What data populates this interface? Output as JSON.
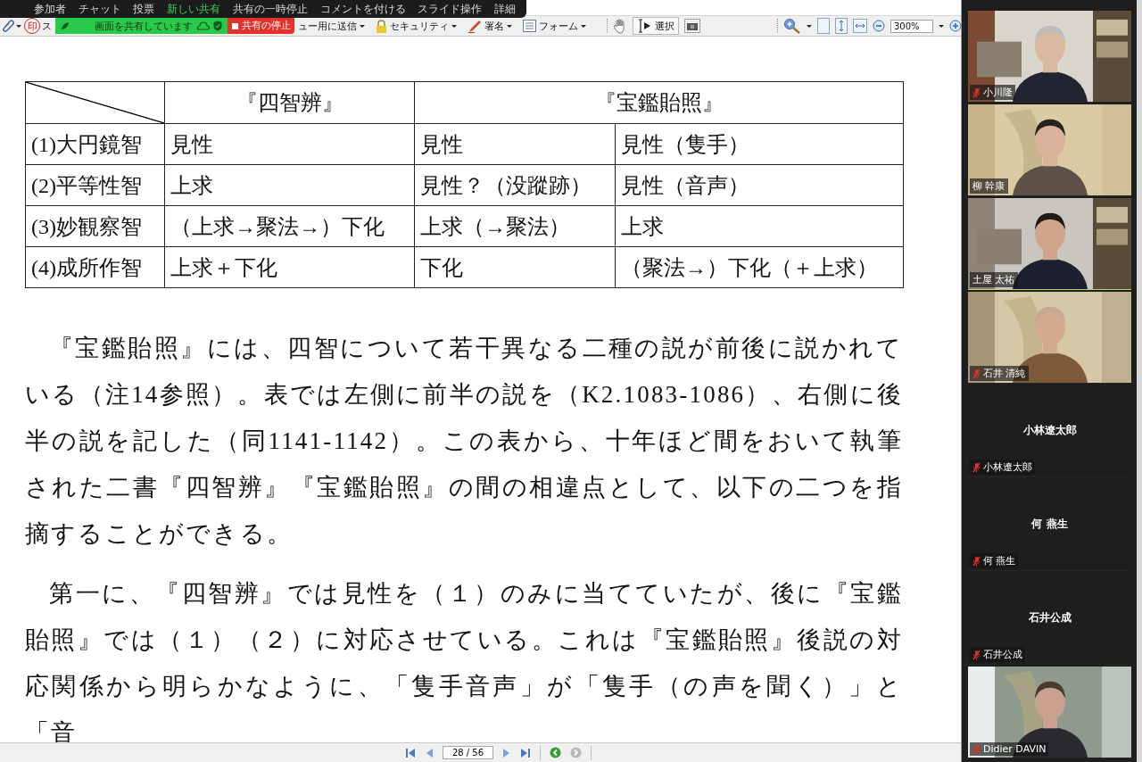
{
  "zoom_toolbar": {
    "items": [
      {
        "label": "参加者",
        "highlighted": false
      },
      {
        "label": "チャット",
        "highlighted": false
      },
      {
        "label": "投票",
        "highlighted": false
      },
      {
        "label": "新しい共有",
        "highlighted": true
      },
      {
        "label": "共有の一時停止",
        "highlighted": false
      },
      {
        "label": "コメントを付ける",
        "highlighted": false
      },
      {
        "label": "スライド操作",
        "highlighted": false
      },
      {
        "label": "詳細",
        "highlighted": false
      }
    ]
  },
  "share_banner": {
    "status": "画面を共有しています",
    "stop_button": "共有の停止"
  },
  "pdf_toolbar": {
    "stamp_icon_text": "印",
    "partial_label": "ス",
    "buttons": [
      {
        "label": "ュー用に送信",
        "kind": "text"
      },
      {
        "label": "セキュリティ",
        "kind": "lock"
      },
      {
        "label": "署名",
        "kind": "pen"
      },
      {
        "label": "フォーム",
        "kind": "form"
      }
    ],
    "select_tool": "選択",
    "zoom": "300%"
  },
  "table": {
    "header": [
      "『四智辨』",
      "『宝鑑貽照』"
    ],
    "rows": [
      [
        "(1)大円鏡智",
        "見性",
        "見性",
        "見性（隻手）"
      ],
      [
        "(2)平等性智",
        "上求",
        "見性？（没蹤跡）",
        "見性（音声）"
      ],
      [
        "(3)妙観察智",
        "（上求→聚法→）下化",
        "上求（→聚法）",
        "上求"
      ],
      [
        "(4)成所作智",
        "上求＋下化",
        "下化",
        "（聚法→）下化（＋上求）"
      ]
    ]
  },
  "paragraphs": [
    "『宝鑑貽照』には、四智について若干異なる二種の説が前後に説かれている（注14参照）。表では左側に前半の説を（K2.1083-1086）、右側に後半の説を記した（同1141-1142）。この表から、十年ほど間をおいて執筆された二書『四智辨』『宝鑑貽照』の間の相違点として、以下の二つを指摘することができる。",
    "第一に、『四智辨』では見性を（１）のみに当てていたが、後に『宝鑑貽照』では（１）（２）に対応させている。これは『宝鑑貽照』後説の対応関係から明らかなように、「隻手音声」が「隻手（の声を聞く）」と「音"
  ],
  "page_nav": {
    "page": "28 / 56"
  },
  "participants": [
    {
      "name": "小川隆",
      "kind": "video",
      "muted": true,
      "active_speaker": false
    },
    {
      "name": "柳 幹康",
      "kind": "video",
      "muted": false,
      "active_speaker": false
    },
    {
      "name": "土屋 太祐",
      "kind": "video",
      "muted": false,
      "active_speaker": true
    },
    {
      "name": "石井 清純",
      "kind": "video",
      "muted": true,
      "active_speaker": false
    },
    {
      "name": "小林遼太郎",
      "tile_name": "小林遼太郎",
      "kind": "no_video",
      "muted": true,
      "active_speaker": false
    },
    {
      "name": "何 燕生",
      "tile_name": "何 燕生",
      "kind": "no_video",
      "muted": true,
      "active_speaker": false
    },
    {
      "name": "石井公成",
      "tile_name": "石井公成",
      "kind": "no_video",
      "muted": true,
      "active_speaker": false
    },
    {
      "name": "Didier DAVIN",
      "kind": "video",
      "muted": true,
      "active_speaker": false
    }
  ]
}
